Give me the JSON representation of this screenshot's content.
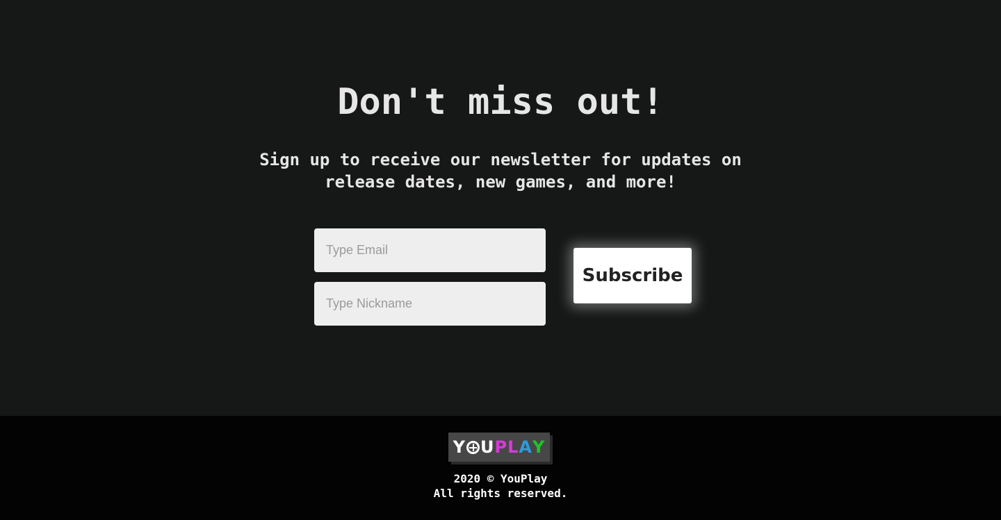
{
  "newsletter": {
    "title": "Don't miss out!",
    "subtitle": "Sign up to receive our newsletter for updates on release dates, new games, and more!",
    "email_placeholder": "Type Email",
    "email_value": "",
    "nickname_placeholder": "Type Nickname",
    "nickname_value": "",
    "subscribe_label": "Subscribe"
  },
  "footer": {
    "logo": {
      "letters": [
        "Y",
        "U",
        "P",
        "L",
        "A",
        "Y"
      ],
      "icon": "gamepad-icon",
      "colors": {
        "Y": "#ffffff",
        "U": "#ffffff",
        "P": "#d83ad8",
        "L": "#d83ad8",
        "A": "#2f9ad8",
        "Y2": "#1fc427"
      }
    },
    "copyright_line1": "2020 © YouPlay",
    "copyright_line2": "All rights reserved."
  },
  "colors": {
    "background": "#161717",
    "footer_background": "#030303",
    "text": "#e6e6e6",
    "button_bg": "#ffffff",
    "input_bg": "#eeeeee"
  }
}
